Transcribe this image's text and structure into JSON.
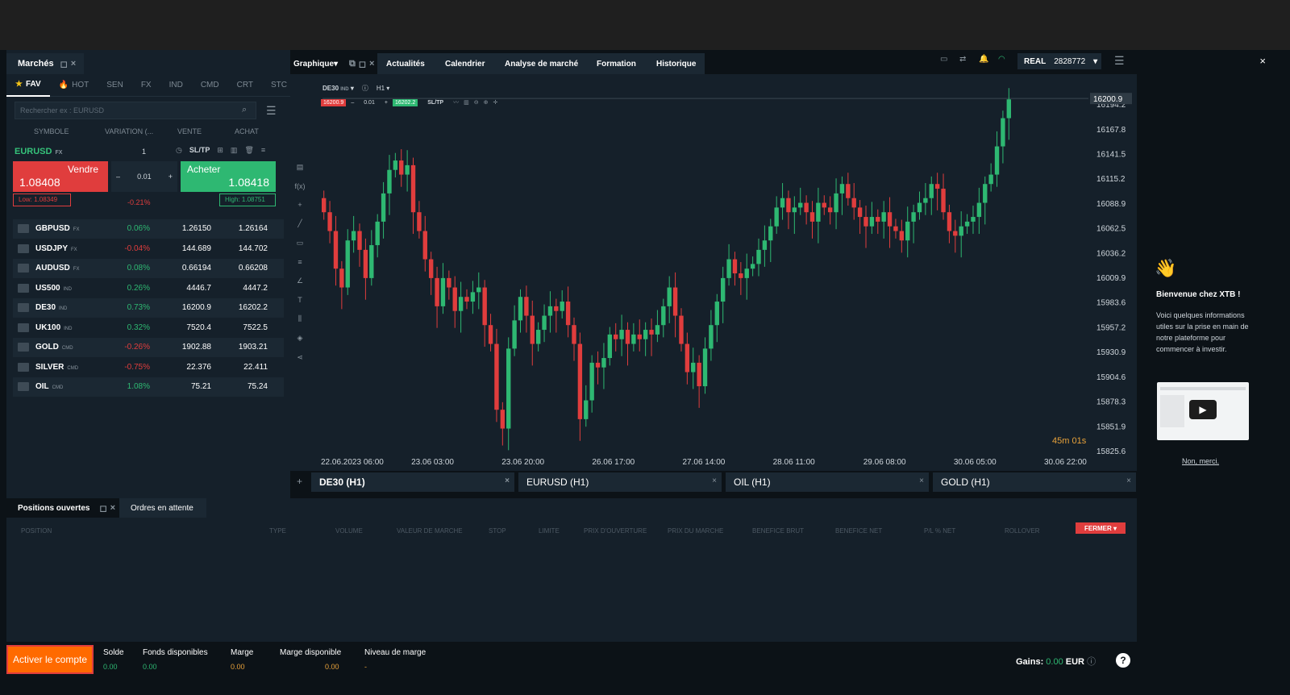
{
  "markets": {
    "title": "Marchés",
    "tabs": [
      "FAV",
      "HOT",
      "SEN",
      "FX",
      "IND",
      "CMD",
      "CRT",
      "STC"
    ],
    "more": "»",
    "search_placeholder": "Rechercher ex : EURUSD",
    "columns": [
      "SYMBOLE",
      "VARIATION (...",
      "VENTE",
      "ACHAT"
    ],
    "selected": {
      "symbol": "EURUSD",
      "type": "FX",
      "volume": "1",
      "sltp": "SL/TP",
      "sell_label": "Vendre",
      "sell_price": "1.08408",
      "buy_label": "Acheter",
      "buy_price": "1.08418",
      "lot": "0.01",
      "low": "Low: 1.08349",
      "change": "-0.21%",
      "high": "High: 1.08751"
    },
    "rows": [
      {
        "symbol": "GBPUSD",
        "type": "FX",
        "var": "0.06%",
        "sell": "1.26150",
        "buy": "1.26164",
        "up": true
      },
      {
        "symbol": "USDJPY",
        "type": "FX",
        "var": "-0.04%",
        "sell": "144.689",
        "buy": "144.702",
        "up": false
      },
      {
        "symbol": "AUDUSD",
        "type": "FX",
        "var": "0.08%",
        "sell": "0.66194",
        "buy": "0.66208",
        "up": true
      },
      {
        "symbol": "US500",
        "type": "IND",
        "var": "0.26%",
        "sell": "4446.7",
        "buy": "4447.2",
        "up": true
      },
      {
        "symbol": "DE30",
        "type": "IND",
        "var": "0.73%",
        "sell": "16200.9",
        "buy": "16202.2",
        "up": true
      },
      {
        "symbol": "UK100",
        "type": "IND",
        "var": "0.32%",
        "sell": "7520.4",
        "buy": "7522.5",
        "up": true
      },
      {
        "symbol": "GOLD",
        "type": "CMD",
        "var": "-0.26%",
        "sell": "1902.88",
        "buy": "1903.21",
        "up": false
      },
      {
        "symbol": "SILVER",
        "type": "CMD",
        "var": "-0.75%",
        "sell": "22.376",
        "buy": "22.411",
        "up": false
      },
      {
        "symbol": "OIL",
        "type": "CMD",
        "var": "1.08%",
        "sell": "75.21",
        "buy": "75.24",
        "up": true
      }
    ]
  },
  "header": {
    "tabs": [
      "Graphique",
      "Actualités",
      "Calendrier",
      "Analyse de marché",
      "Formation",
      "Historique"
    ],
    "account_type": "REAL",
    "account_id": "2828772"
  },
  "chart": {
    "symbol": "DE30",
    "symbol_type": "IND",
    "timeframe": "H1",
    "sell": "16200.9",
    "lot": "0.01",
    "buy": "16202.2",
    "sltp": "SL/TP",
    "last": "16200.9",
    "countdown": "45m 01s"
  },
  "chart_data": {
    "type": "candlestick",
    "x_ticks": [
      "22.06.2023 06:00",
      "23.06 03:00",
      "23.06 20:00",
      "26.06 17:00",
      "27.06 14:00",
      "28.06 11:00",
      "29.06 08:00",
      "30.06 05:00",
      "30.06 22:00"
    ],
    "y_ticks": [
      "16194.2",
      "16167.8",
      "16141.5",
      "16115.2",
      "16088.9",
      "16062.5",
      "16036.2",
      "16009.9",
      "15983.6",
      "15957.2",
      "15930.9",
      "15904.6",
      "15878.3",
      "15851.9",
      "15825.6"
    ],
    "ylim": [
      15825.6,
      16194.2
    ],
    "close": [
      16080,
      16060,
      16020,
      16000,
      16050,
      16060,
      16040,
      16010,
      16045,
      16070,
      16100,
      16125,
      16135,
      16120,
      16130,
      16080,
      16060,
      16030,
      16010,
      15980,
      16010,
      16000,
      15975,
      15990,
      15985,
      15995,
      16000,
      15960,
      15940,
      15870,
      15850,
      15935,
      15965,
      15990,
      15970,
      15940,
      15955,
      15970,
      15980,
      15975,
      15985,
      15960,
      15940,
      15860,
      15880,
      15920,
      15915,
      15925,
      15950,
      15945,
      15955,
      15940,
      15950,
      15945,
      15955,
      15950,
      15960,
      15980,
      16000,
      15970,
      15940,
      15910,
      15920,
      15895,
      15935,
      15960,
      15985,
      16010,
      16030,
      16015,
      16010,
      16020,
      16025,
      16040,
      16050,
      16065,
      16085,
      16095,
      16080,
      16085,
      16090,
      16080,
      16070,
      16090,
      16085,
      16080,
      16100,
      16110,
      16095,
      16085,
      16075,
      16065,
      16075,
      16070,
      16080,
      16065,
      16060,
      16050,
      16070,
      16080,
      16090,
      16095,
      16110,
      16105,
      16080,
      16060,
      16055,
      16065,
      16070,
      16075,
      16090,
      16110,
      16120,
      16150,
      16180,
      16200
    ],
    "current": 16200.9
  },
  "tabs_bottom": [
    "DE30 (H1)",
    "EURUSD (H1)",
    "OIL (H1)",
    "GOLD (H1)"
  ],
  "positions": {
    "tab_open": "Positions ouvertes",
    "tab_pending": "Ordres en attente",
    "columns": [
      "POSITION",
      "TYPE",
      "VOLUME",
      "VALEUR DE MARCHE",
      "STOP",
      "LIMITE",
      "PRIX D'OUVERTURE",
      "PRIX DU MARCHE",
      "BENEFICE BRUT",
      "BENEFICE NET",
      "P/L % NET",
      "ROLLOVER"
    ],
    "close_btn": "FERMER ▾"
  },
  "footer": {
    "activate": "Activer le compte",
    "items": [
      {
        "label": "Solde",
        "value": "0.00"
      },
      {
        "label": "Fonds disponibles",
        "value": "0.00"
      },
      {
        "label": "Marge",
        "value": "0.00"
      },
      {
        "label": "Marge disponible",
        "value": "0.00"
      },
      {
        "label": "Niveau de marge",
        "value": "-"
      }
    ],
    "gains_label": "Gains:",
    "gains_value": "0.00",
    "gains_currency": "EUR"
  },
  "side": {
    "title": "Bienvenue chez XTB !",
    "text": "Voici quelques informations utiles sur la prise en main de notre plateforme pour commencer à investir.",
    "dismiss": "Non, merci."
  },
  "colors": {
    "up": "#2eb872",
    "down": "#e03d3d",
    "accent": "#ff6a00"
  }
}
